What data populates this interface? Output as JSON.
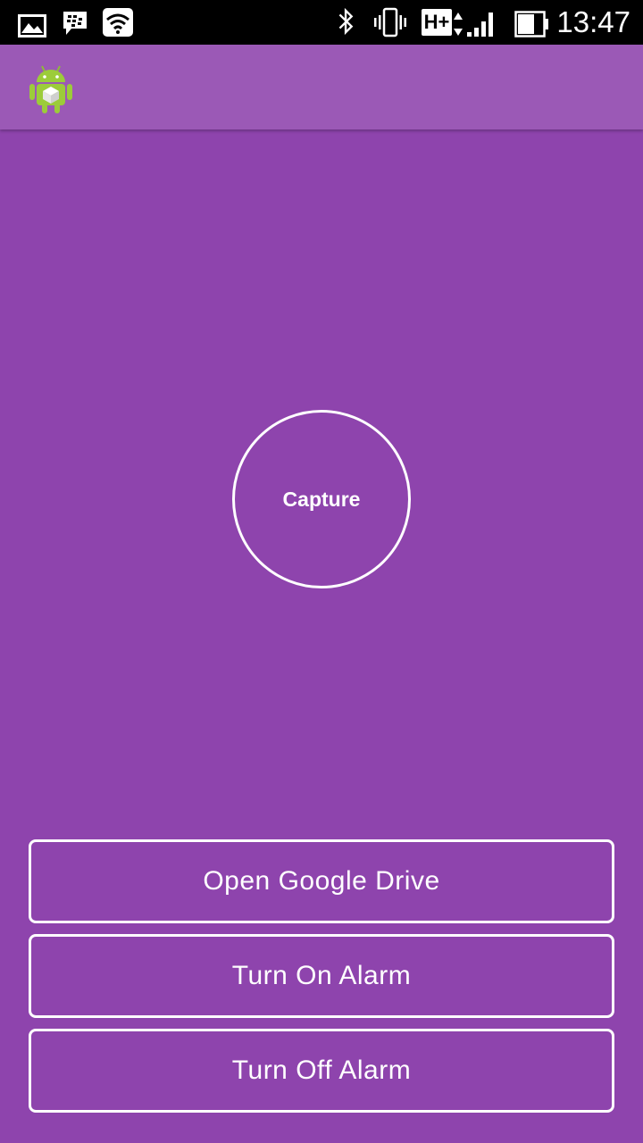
{
  "status_bar": {
    "time": "13:47",
    "network_label": "H+",
    "icons": [
      "gallery-icon",
      "bbm-icon",
      "wifi-icon",
      "bluetooth-icon",
      "vibrate-icon",
      "network-type-icon",
      "signal-icon",
      "battery-icon"
    ]
  },
  "action_bar": {
    "app_icon": "android-app-icon"
  },
  "main": {
    "capture_label": "Capture"
  },
  "buttons": {
    "open_drive": "Open Google Drive",
    "turn_on_alarm": "Turn On Alarm",
    "turn_off_alarm": "Turn Off Alarm"
  },
  "colors": {
    "background": "#8e44ad",
    "action_bar": "#9b59b6",
    "status_bar": "#000000",
    "foreground": "#ffffff"
  }
}
